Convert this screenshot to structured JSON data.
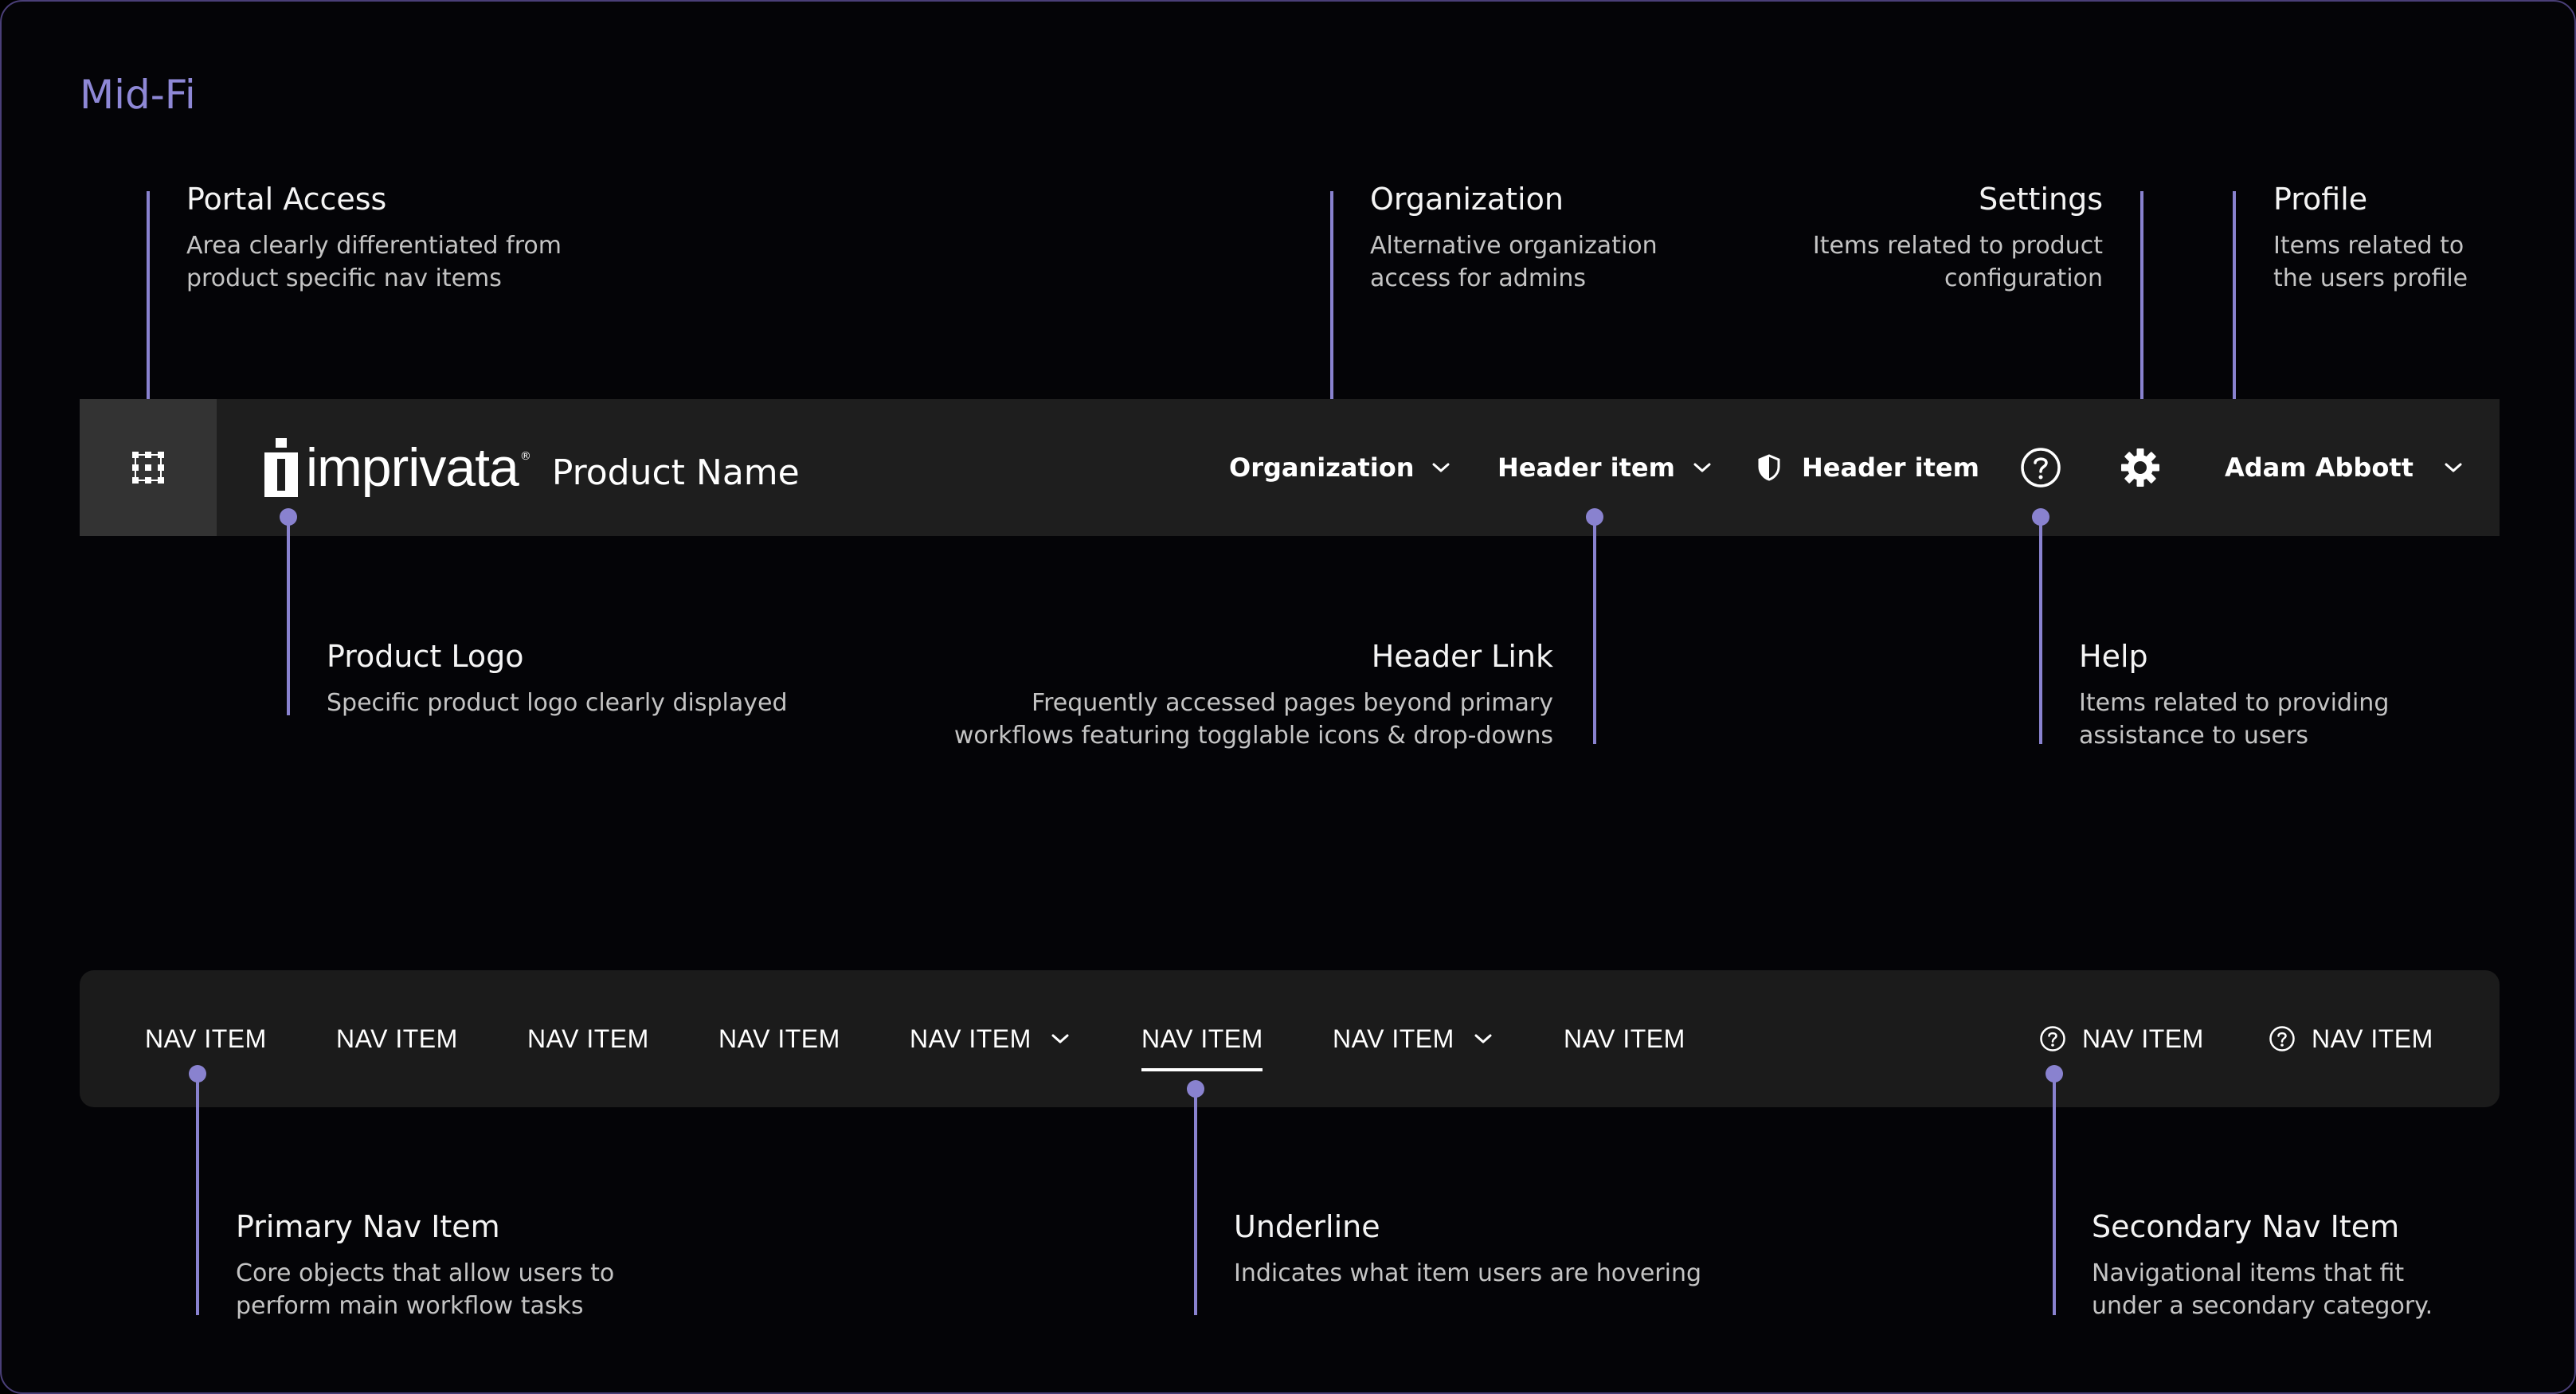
{
  "title": "Mid-Fi",
  "colors": {
    "accent": "#8982cf",
    "bar": "#1e1e1e",
    "portal_bg": "#333333",
    "text": "#ffffff"
  },
  "header": {
    "brand": "imprivata",
    "brand_mark": "®",
    "product_name": "Product Name",
    "organization_label": "Organization",
    "header_item_1": "Header item",
    "header_item_2": "Header item",
    "profile_name": "Adam Abbott",
    "icons": [
      "grid-icon",
      "chevron-down-icon",
      "shield-icon",
      "help-icon",
      "gear-icon"
    ]
  },
  "nav": {
    "items": [
      "NAV ITEM",
      "NAV ITEM",
      "NAV ITEM",
      "NAV ITEM",
      "NAV ITEM",
      "NAV ITEM",
      "NAV ITEM",
      "NAV ITEM"
    ],
    "secondary": [
      "NAV ITEM",
      "NAV ITEM"
    ],
    "active_index": 5
  },
  "callouts": {
    "portal_access": {
      "title": "Portal Access",
      "desc1": "Area clearly differentiated from",
      "desc2": "product specific nav items"
    },
    "organization": {
      "title": "Organization",
      "desc1": "Alternative organization",
      "desc2": "access for admins"
    },
    "settings": {
      "title": "Settings",
      "desc1": "Items related to product",
      "desc2": "configuration"
    },
    "profile": {
      "title": "Profile",
      "desc1": "Items related to",
      "desc2": "the users profile"
    },
    "product_logo": {
      "title": "Product Logo",
      "desc1": "Specific product logo clearly displayed"
    },
    "header_link": {
      "title": "Header Link",
      "desc1": "Frequently accessed pages beyond primary",
      "desc2": "workflows featuring togglable icons & drop-downs"
    },
    "help": {
      "title": "Help",
      "desc1": "Items related to providing",
      "desc2": "assistance to users"
    },
    "primary_nav": {
      "title": "Primary Nav Item",
      "desc1": "Core objects that allow users to",
      "desc2": "perform main workflow tasks"
    },
    "underline": {
      "title": "Underline",
      "desc1": "Indicates what item users are hovering"
    },
    "secondary_nav": {
      "title": "Secondary Nav Item",
      "desc1": "Navigational items that fit",
      "desc2": "under a secondary category."
    }
  }
}
